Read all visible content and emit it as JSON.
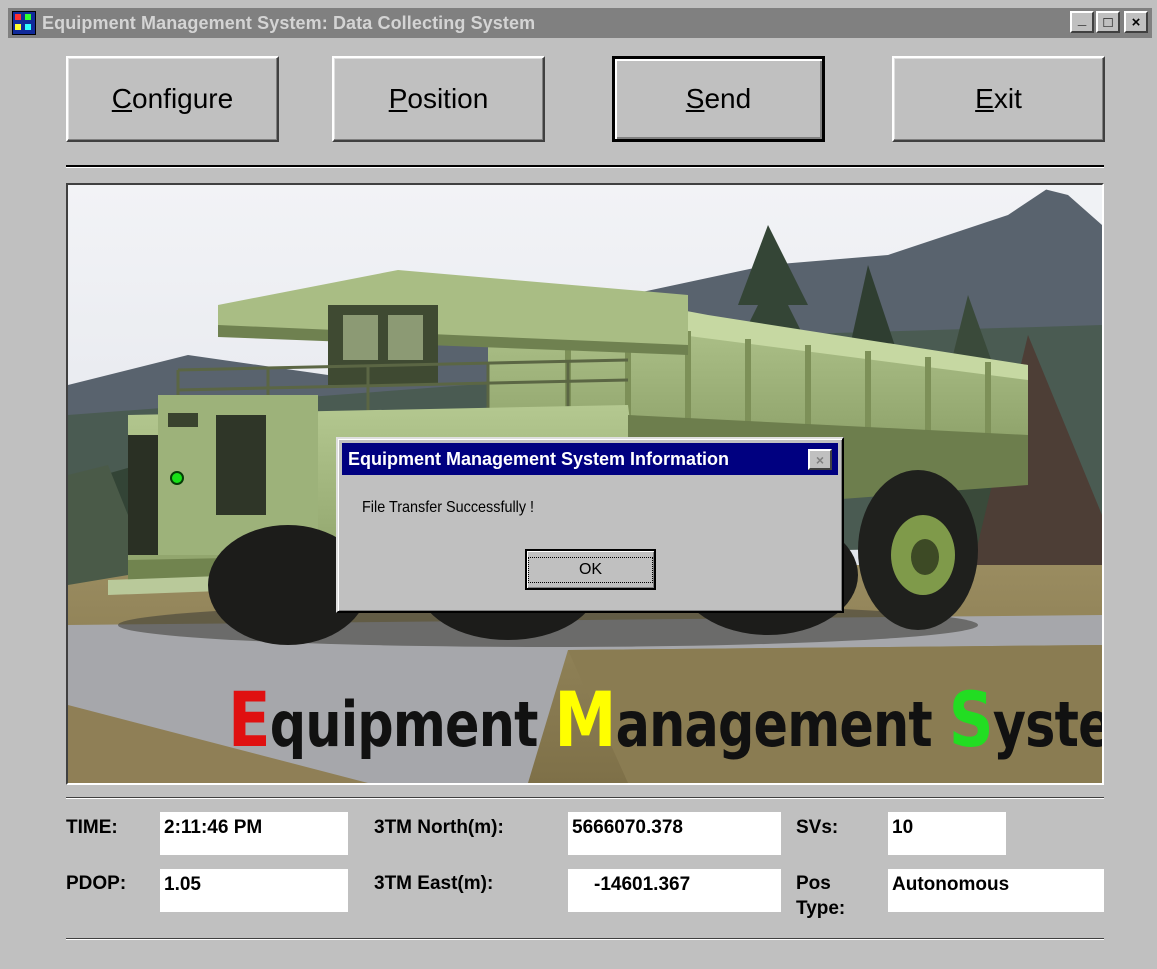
{
  "window": {
    "title": "Equipment Management System: Data Collecting System",
    "controls": {
      "minimize": "_",
      "maximize": "□",
      "close": "×"
    }
  },
  "toolbar": {
    "configure": {
      "accel": "C",
      "rest": "onfigure"
    },
    "position": {
      "accel": "P",
      "rest": "osition"
    },
    "send": {
      "accel": "S",
      "rest": "end"
    },
    "exit": {
      "accel": "E",
      "rest": "xit"
    }
  },
  "banner": {
    "letter1": "E",
    "word1": "quipment ",
    "letter2": "M",
    "word2": "anagement ",
    "letter3": "S",
    "word3": "ystem"
  },
  "dialog": {
    "title": "Equipment Management System Information",
    "close": "×",
    "message": "File Transfer Successfully !",
    "ok": "OK"
  },
  "status": {
    "time_label": "TIME:",
    "time_value": "2:11:46 PM",
    "pdop_label": "PDOP:",
    "pdop_value": "1.05",
    "north_label": "3TM North(m):",
    "north_value": "5666070.378",
    "east_label": "3TM East(m):",
    "east_value": "-14601.367",
    "svs_label": "SVs:",
    "svs_value": "10",
    "postype_label_1": "Pos",
    "postype_label_2": "Type:",
    "postype_value": "Autonomous"
  },
  "colors": {
    "titlebar_inactive": "#808080",
    "dialog_titlebar": "#000080",
    "banner_red": "#e01010",
    "banner_yellow": "#ffff00",
    "banner_green": "#22dd22",
    "gps_dot": "#18e018"
  }
}
